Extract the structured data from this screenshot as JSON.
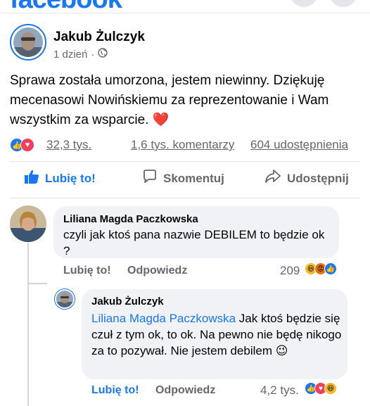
{
  "header": {
    "logo_text": "facebook"
  },
  "post": {
    "author": "Jakub Żulczyk",
    "time": "1 dzień",
    "separator": "·",
    "privacy_icon": "globe-icon",
    "text": "Sprawa została umorzona, jestem niewinny. Dziękuję mecenasowi Nowińskiemu za reprezentowanie i Wam wszystkim za wsparcie.",
    "emoji": "❤️"
  },
  "stats": {
    "reactions": "32,3 tys.",
    "comments": "1,6 tys. komentarzy",
    "shares": "604 udostępnienia"
  },
  "actions": {
    "like": "Lubię to!",
    "comment": "Skomentuj",
    "share": "Udostępnij"
  },
  "comments": [
    {
      "author": "Liliana Magda Paczkowska",
      "text": "czyli jak ktoś  pana nazwie DEBILEM to będzie ok ?",
      "like_label": "Lubię to!",
      "reply_label": "Odpowiedz",
      "reaction_count": "209"
    },
    {
      "author": "Jakub Żulczyk",
      "mention": "Liliana Magda Paczkowska",
      "text": " Jak ktoś będzie się czuł z tym ok, to ok. Na pewno nie będę nikogo za to pozywał. Nie jestem debilem",
      "emoji": "😉",
      "like_label": "Lubię to!",
      "reply_label": "Odpowiedz",
      "reaction_count": "4,2 tys."
    }
  ],
  "colors": {
    "brand": "#1877f2",
    "secondary_text": "#65676b",
    "bubble": "#f0f2f5",
    "love": "#f33e58"
  }
}
